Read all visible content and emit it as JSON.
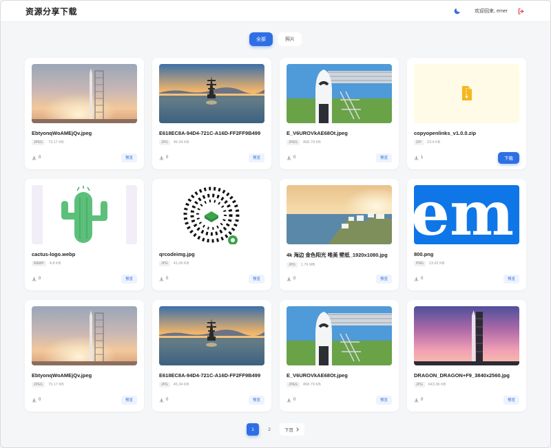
{
  "header": {
    "brand": "资源分享下载",
    "welcome": "欢迎回来, emer"
  },
  "filters": [
    {
      "label": "全部",
      "active": true
    },
    {
      "label": "照片",
      "active": false
    }
  ],
  "cards": [
    {
      "name": "EbtyonqWoAMEjQv.jpeg",
      "type": "JPEG",
      "size": "73.17 KB",
      "downloads": "0",
      "action": "预览",
      "thumb": "rocket-sunset"
    },
    {
      "name": "E618EC8A-94D4-721C-A16D-FF2FF9B499",
      "type": "JPG",
      "size": "45.34 KB",
      "downloads": "0",
      "action": "预览",
      "thumb": "pagoda-lake"
    },
    {
      "name": "E_V6UROVkAE68Ot.jpeg",
      "type": "JPEG",
      "size": "868.79 KB",
      "downloads": "0",
      "action": "预览",
      "thumb": "dragon-capsule"
    },
    {
      "name": "copyopenlinks_v1.0.0.zip",
      "type": "ZIP",
      "size": "23.4 KB",
      "downloads": "1",
      "action": "下载",
      "thumb": "zip-file"
    },
    {
      "name": "cactus-logo.webp",
      "type": "WEBP",
      "size": "4.8 KB",
      "downloads": "0",
      "action": "预览",
      "thumb": "cactus"
    },
    {
      "name": "qrcodeimg.jpg",
      "type": "JPG",
      "size": "41.06 KB",
      "downloads": "0",
      "action": "预览",
      "thumb": "qrcode"
    },
    {
      "name": "4k 海边 金色阳光 唯美 壁纸_1920x1080.jpg",
      "type": "JPG",
      "size": "1.76 MB",
      "downloads": "0",
      "action": "预览",
      "thumb": "seaside"
    },
    {
      "name": "800.png",
      "type": "PNG",
      "size": "13.62 KB",
      "downloads": "0",
      "action": "预览",
      "thumb": "em-logo"
    },
    {
      "name": "EbtyonqWoAMEjQv.jpeg",
      "type": "JPEG",
      "size": "73.17 KB",
      "downloads": "0",
      "action": "预览",
      "thumb": "rocket-sunset"
    },
    {
      "name": "E618EC8A-94D4-721C-A16D-FF2FF9B499",
      "type": "JPG",
      "size": "45.34 KB",
      "downloads": "0",
      "action": "预览",
      "thumb": "pagoda-lake"
    },
    {
      "name": "E_V6UROVkAE68Ot.jpeg",
      "type": "JPEG",
      "size": "868.79 KB",
      "downloads": "0",
      "action": "预览",
      "thumb": "dragon-capsule"
    },
    {
      "name": "DRAGON_DRAGON+F9_3840x2560.jpg",
      "type": "JPG",
      "size": "643.36 KB",
      "downloads": "0",
      "action": "预览",
      "thumb": "falcon-pink"
    }
  ],
  "pagination": {
    "pages": [
      "1",
      "2"
    ],
    "current": "1",
    "next_label": "下页"
  },
  "colors": {
    "accent": "#2f6fe4",
    "logout": "#e5484d",
    "moon": "#3b6fd9"
  },
  "icons": {
    "theme": "moon-icon",
    "logout": "logout-icon",
    "download_count": "download-icon",
    "next": "chevron-right-icon"
  }
}
